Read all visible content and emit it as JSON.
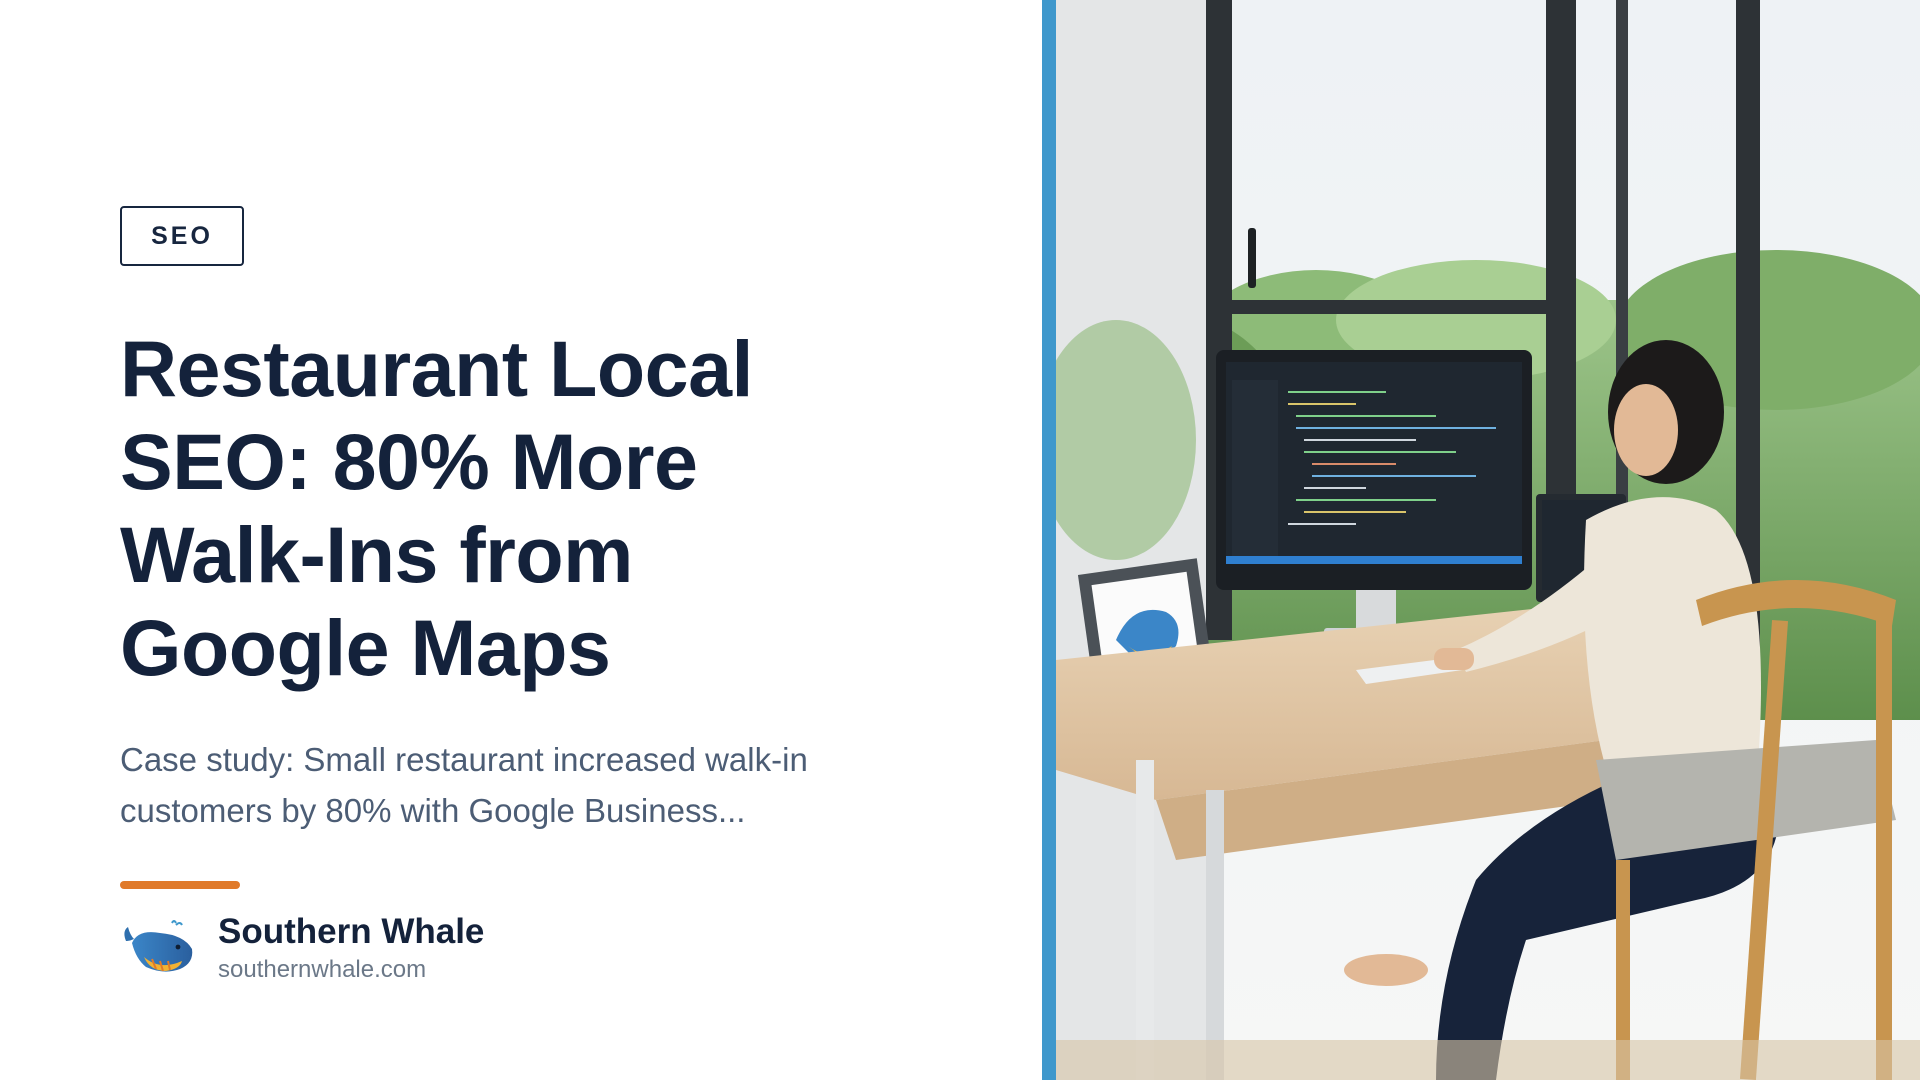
{
  "tag": {
    "label": "SEO"
  },
  "article": {
    "title": "Restaurant Local SEO: 80% More Walk-Ins from Google Maps",
    "description": "Case study: Small restaurant increased walk-in customers by 80% with Google Business..."
  },
  "brand": {
    "name": "Southern Whale",
    "url": "southernwhale.com",
    "logo_icon": "whale-logo-icon"
  },
  "colors": {
    "title": "#14223b",
    "description": "#4c5d75",
    "accent_bar": "#e07a2a",
    "divider": "#3f98cc"
  },
  "photo": {
    "subject": "photo of a woman coding at a desk by a window with a framed whale picture"
  }
}
